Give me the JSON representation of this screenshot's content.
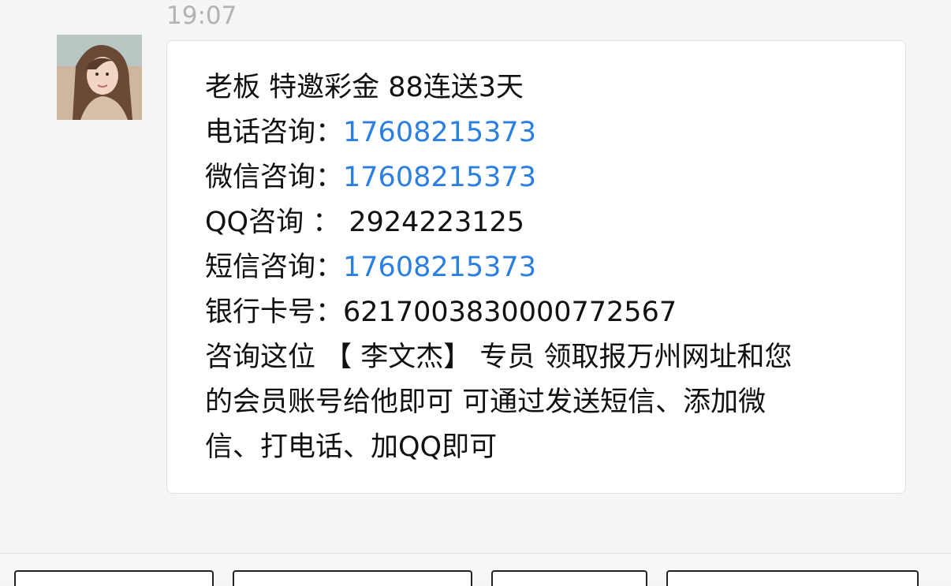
{
  "chat": {
    "timestamp": "19:07",
    "sender": {
      "avatar_icon": "profile-photo"
    },
    "message": {
      "line1": "老板 特邀彩金 88连送3天",
      "phone_label": "电话咨询：",
      "phone_value": "17608215373",
      "wechat_label": "微信咨询：",
      "wechat_value": "17608215373",
      "qq_label": "QQ咨询 ：",
      "qq_value": "2924223125",
      "sms_label": "短信咨询：",
      "sms_value": "17608215373",
      "bank_label": "银行卡号：",
      "bank_value": "6217003830000772567",
      "text_line1": "咨询这位 【 李文杰】 专员 领取报万州网址和您",
      "text_line2": "的会员账号给他即可 可通过发送短信、添加微",
      "text_line3": "信、打电话、加QQ即可"
    }
  },
  "colors": {
    "link": "#2b7fe0",
    "bubble_bg": "#ffffff",
    "page_bg": "#f5f5f5"
  }
}
